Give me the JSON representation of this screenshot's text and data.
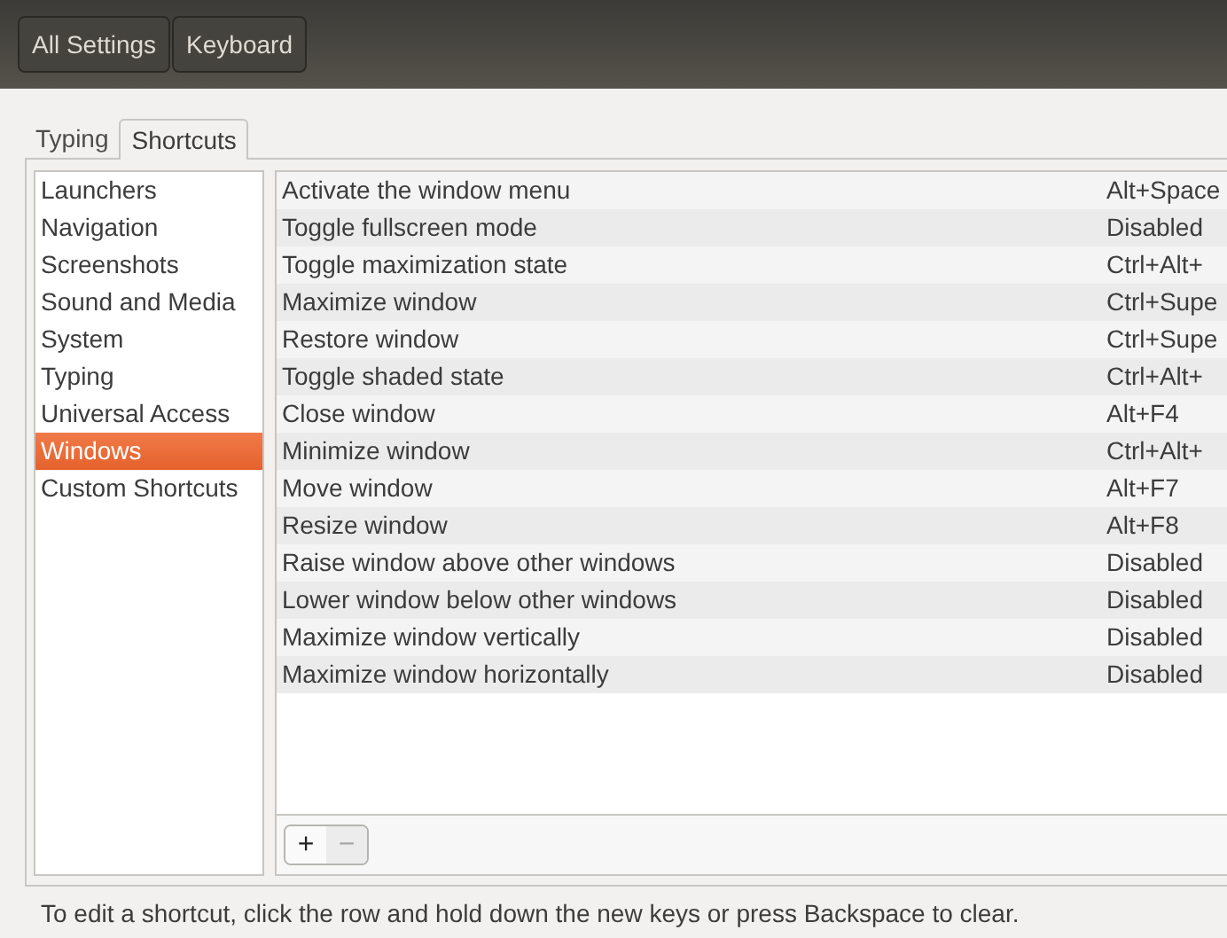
{
  "header": {
    "buttons": [
      {
        "label": "All Settings",
        "selected": false
      },
      {
        "label": "Keyboard",
        "selected": false
      }
    ]
  },
  "tabs": [
    {
      "label": "Typing",
      "selected": false
    },
    {
      "label": "Shortcuts",
      "selected": true
    }
  ],
  "categories": [
    {
      "label": "Launchers",
      "selected": false
    },
    {
      "label": "Navigation",
      "selected": false
    },
    {
      "label": "Screenshots",
      "selected": false
    },
    {
      "label": "Sound and Media",
      "selected": false
    },
    {
      "label": "System",
      "selected": false
    },
    {
      "label": "Typing",
      "selected": false
    },
    {
      "label": "Universal Access",
      "selected": false
    },
    {
      "label": "Windows",
      "selected": true
    },
    {
      "label": "Custom Shortcuts",
      "selected": false
    }
  ],
  "shortcuts": [
    {
      "action": "Activate the window menu",
      "keys": "Alt+Space"
    },
    {
      "action": "Toggle fullscreen mode",
      "keys": "Disabled"
    },
    {
      "action": "Toggle maximization state",
      "keys": "Ctrl+Alt+"
    },
    {
      "action": "Maximize window",
      "keys": "Ctrl+Supe"
    },
    {
      "action": "Restore window",
      "keys": "Ctrl+Supe"
    },
    {
      "action": "Toggle shaded state",
      "keys": "Ctrl+Alt+"
    },
    {
      "action": "Close window",
      "keys": "Alt+F4"
    },
    {
      "action": "Minimize window",
      "keys": "Ctrl+Alt+"
    },
    {
      "action": "Move window",
      "keys": "Alt+F7"
    },
    {
      "action": "Resize window",
      "keys": "Alt+F8"
    },
    {
      "action": "Raise window above other windows",
      "keys": "Disabled"
    },
    {
      "action": "Lower window below other windows",
      "keys": "Disabled"
    },
    {
      "action": "Maximize window vertically",
      "keys": "Disabled"
    },
    {
      "action": "Maximize window horizontally",
      "keys": "Disabled"
    }
  ],
  "toolbar": [
    {
      "label": "+",
      "disabled": false
    },
    {
      "label": "−",
      "disabled": true
    }
  ],
  "hint": "To edit a shortcut, click the row and hold down the new keys or press Backspace to clear."
}
